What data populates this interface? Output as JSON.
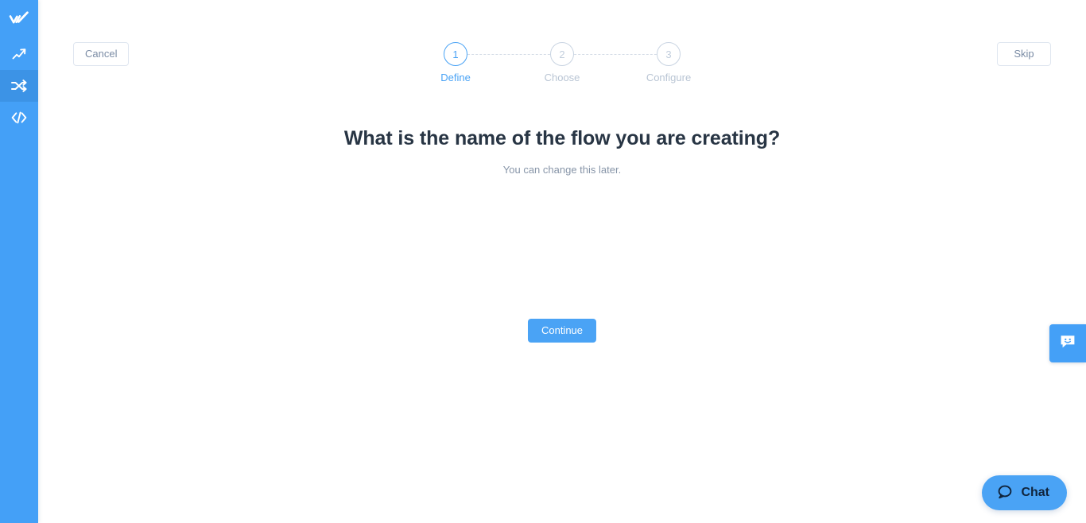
{
  "sidebar": {
    "accent_color": "#44a0f7",
    "active_color": "#3c93e6",
    "items": [
      {
        "id": "logo",
        "icon": "workato-logo-icon",
        "label": "Workato",
        "active": false
      },
      {
        "id": "dashboard",
        "icon": "trending-up-icon",
        "label": "Dashboard",
        "active": false
      },
      {
        "id": "recipes",
        "icon": "shuffle-icon",
        "label": "Recipes",
        "active": true
      },
      {
        "id": "tools",
        "icon": "code-icon",
        "label": "Tools",
        "active": false
      }
    ]
  },
  "topbar": {
    "cancel_label": "Cancel",
    "skip_label": "Skip"
  },
  "stepper": {
    "active_color": "#4aa3f5",
    "inactive_color": "#c2cedd",
    "steps": [
      {
        "number": "1",
        "label": "Define",
        "state": "active"
      },
      {
        "number": "2",
        "label": "Choose",
        "state": "upcoming"
      },
      {
        "number": "3",
        "label": "Configure",
        "state": "upcoming"
      }
    ]
  },
  "content": {
    "headline": "What is the name of the flow you are creating?",
    "subhead": "You can change this later.",
    "name_input": {
      "value": "",
      "placeholder": ""
    },
    "continue_label": "Continue"
  },
  "chat": {
    "pill_label": "Chat",
    "pill_icon": "speech-bubble-icon",
    "tab_icon": "smiley-chat-icon",
    "color": "#4aa3f5"
  }
}
